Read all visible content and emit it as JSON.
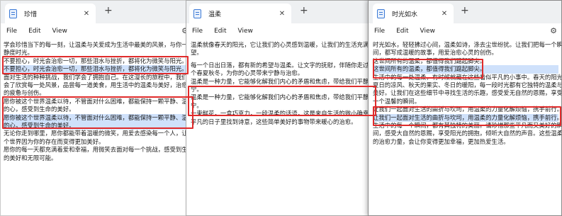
{
  "windows": [
    {
      "title": "珍惜",
      "menu": [
        "File",
        "Edit",
        "View"
      ],
      "lines": [
        "学会珍惜当下的每一刻，让温柔与关爱成为生活中最美的风景，与你一起",
        "静度时光。",
        "不要担心，时光会治愈一切，那些泪水与挫折，都将化为微笑与阳光。",
        "不要担心，时光会治愈一切，那些泪水与挫折，都将化为微笑与阳光。",
        "面对生活的种种挑战，我们学会了拥抱自己。在这漫长的旅程中，我们学",
        "会了欣赏每一处风景，品尝每一道美食，用生活中的温柔与美好，治愈心灵",
        "的疲惫与创伤。",
        "愿你被这个世界温柔以待，不管面对什么困难，都能保持一颗平静、温柔",
        "的心，感受到生命的美好。",
        "愿你被这个世界温柔以待，不管面对什么困难，都能保持一颗平静、温柔",
        "的心，感受到生命的美好。",
        "无论你走到哪里，愿你都能带着温暖的微笑，用爱去感染每一个人，让这",
        "个世界因为你的存在而变得更加美好。",
        "愿你的每一天都充满着爱和幸福，用微笑去面对每一个挑战，感受到生命",
        "的美好和无限可能。"
      ]
    },
    {
      "title": "温柔",
      "menu": [
        "File",
        "Edit",
        "View"
      ],
      "lines": [
        "温柔就像春天的阳光，它让我们的心灵感到温暖，让我们的生活充满希",
        "望。",
        "",
        "每一个日出日落，都有新的希望与温柔。让文字的抚慰，伴随你走过每一",
        "个春夏秋冬，为你的心灵带来宁静与治愈。",
        "温柔是一种力量，它能够化解我们内心的矛盾和焦虑，带给我们平静与安",
        "宁。",
        "温柔是一种力量，它能够化解我们内心的矛盾和焦虑，带给我们平静与安",
        "宁。",
        "一束鲜花，一盒巧克力，一段温柔的话语，这是来自生活的微小确幸。在",
        "平凡的日子里找到诗意，这些简单美好的事物带来暖心的治愈。"
      ]
    },
    {
      "title": "时光如水",
      "menu": [
        "File",
        "Edit",
        "View"
      ],
      "lines": [
        "时光如水，轻轻拂过心间，温柔如诗，涤去尘世纷扰。让我们把每一个瞬",
        "间，都写成温暖的故事，用爱治愈心灵的创伤。",
        "这世间所有的温柔，都值得我们踮起脚尖。",
        "这世间所有的温柔，都值得我们踮起脚尖。",
        "生活中的每一处温柔，有时候就藏在这些看似平凡的小事中。春天的阳光、",
        "夏日的凉风、秋天的果实、冬日的暖阳，每一段时光都有它独特的温柔与",
        "美好。让我们在这些细节中寻找生活的乐趣，感受爱无自然的恩赐，享受每",
        "一个温馨的瞬间。",
        "让我们一起面对生活的曲折与坎坷，用温柔的力量化解烦恼，携手前行。",
        "让我们一起面对生活的曲折与坎坷，用温柔的力量化解烦恼，携手前行。",
        "生活中的每一个瞬间，都有其独特的美丽。请珍惜那些平凡而又美好的瞬",
        "间，感受大自然的恩赐，享受阳光的拥抱，倾听大自然的声音。这些温柔",
        "的治愈力量，会让你变得更加幸福，更加热爱生活。"
      ]
    }
  ]
}
